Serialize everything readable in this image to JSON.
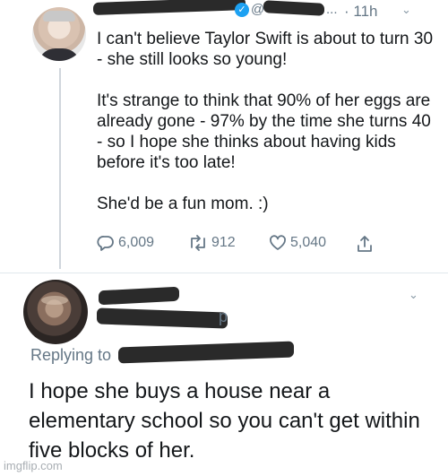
{
  "tweet1": {
    "handle_prefix": "@",
    "handle_suffix": "...",
    "time": "· 11h",
    "text": "I can't believe Taylor Swift is about to turn 30 - she still looks so young!\n\nIt's strange to think that 90% of her eggs are already gone - 97% by the time she turns 40 - so I hope she thinks about having kids before it's too late!\n\nShe'd be a fun mom. :)",
    "replies": "6,009",
    "retweets": "912",
    "likes": "5,040",
    "icons": [
      "reply-icon",
      "retweet-icon",
      "like-icon",
      "share-icon",
      "verified-badge-icon",
      "chevron-down-icon"
    ]
  },
  "tweet2": {
    "handle_tail": "p",
    "replying_label": "Replying to",
    "text": "I hope she buys a house near a elementary school so you can't get within five blocks of her."
  },
  "watermark": "imgflip.com",
  "colors": {
    "text": "#14171a",
    "secondary": "#657786",
    "accent": "#1da1f2",
    "divider": "#e1e8ed"
  }
}
